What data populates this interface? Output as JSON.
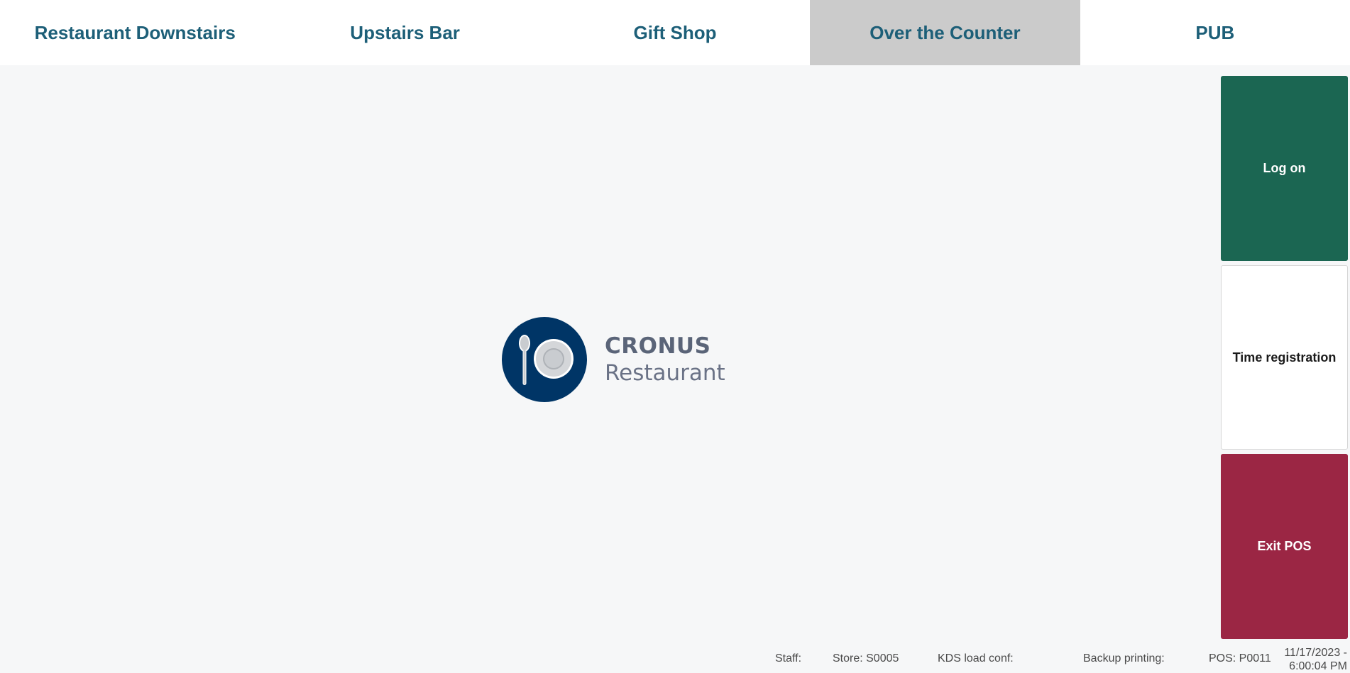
{
  "tabs": [
    {
      "label": "Restaurant Downstairs",
      "active": false
    },
    {
      "label": "Upstairs Bar",
      "active": false
    },
    {
      "label": "Gift Shop",
      "active": false
    },
    {
      "label": "Over the Counter",
      "active": true
    },
    {
      "label": "PUB",
      "active": false
    }
  ],
  "side_buttons": {
    "log_on": "Log on",
    "time_registration": "Time registration",
    "exit_pos": "Exit POS"
  },
  "logo": {
    "brand": "CRONUS",
    "subtitle": "Restaurant",
    "icon": "plate-spoon-icon"
  },
  "status": {
    "staff": "Staff:",
    "store": "Store: S0005",
    "kds": "KDS load conf:",
    "backup": "Backup printing:",
    "pos": "POS: P0011",
    "date": "11/17/2023 -",
    "time": "6:00:04 PM"
  },
  "colors": {
    "tab_text": "#1d5f78",
    "tab_active_bg": "#cbcbcb",
    "log_on_bg": "#1b6652",
    "exit_bg": "#9b2644",
    "logo_circle": "#003566"
  }
}
